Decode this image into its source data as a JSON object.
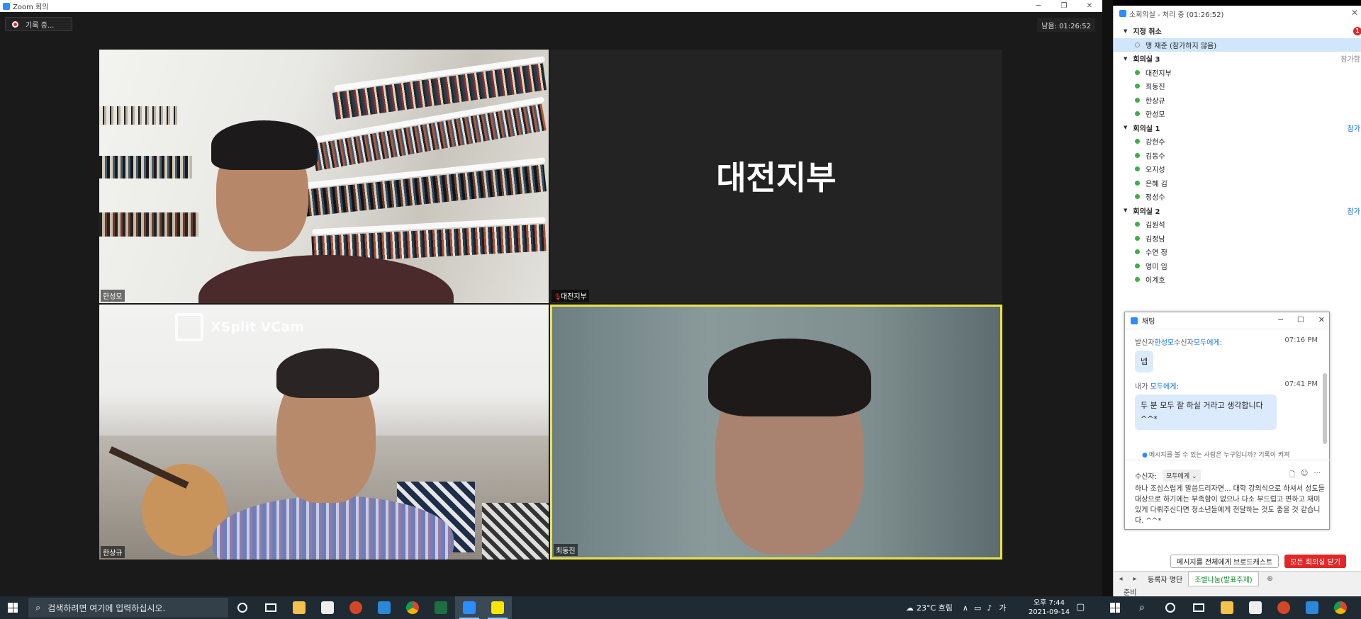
{
  "window": {
    "title": "Zoom 회의",
    "minimize": "─",
    "restore": "❐",
    "close": "✕"
  },
  "recording": {
    "label": "기록 중..."
  },
  "timer": {
    "text": "남음: 01:26:52"
  },
  "tiles": [
    {
      "name": "한성모"
    },
    {
      "name": "대전지부",
      "center_label": "대전지부"
    },
    {
      "name": "한상규",
      "overlay": "XSplit VCam"
    },
    {
      "name": "최동진"
    }
  ],
  "breakout": {
    "title": "소회의실 - 처리 중 (01:26:52)",
    "close": "✕",
    "groups": [
      {
        "label": "지정 취소",
        "badge": "1",
        "members": [
          {
            "name": "맹 재준 (참가하지 않음)",
            "joined": false
          }
        ]
      },
      {
        "label": "회의실 3",
        "action": "참가함",
        "members": [
          {
            "name": "대전지부",
            "joined": true
          },
          {
            "name": "최동진",
            "joined": true
          },
          {
            "name": "한상규",
            "joined": true
          },
          {
            "name": "한성모",
            "joined": true
          }
        ]
      },
      {
        "label": "회의실 1",
        "action": "참가",
        "members": [
          {
            "name": "강현수",
            "joined": true
          },
          {
            "name": "김동수",
            "joined": true
          },
          {
            "name": "오지성",
            "joined": true
          },
          {
            "name": "은혜 김",
            "joined": true
          },
          {
            "name": "정성수",
            "joined": true
          }
        ]
      },
      {
        "label": "회의실 2",
        "action": "참가",
        "members": [
          {
            "name": "김원석",
            "joined": true
          },
          {
            "name": "김정남",
            "joined": true
          },
          {
            "name": "수연 정",
            "joined": true
          },
          {
            "name": "영미 임",
            "joined": true
          },
          {
            "name": "이계호",
            "joined": true
          }
        ]
      }
    ],
    "broadcast_button": "메시지를 전체에게 브로드캐스트",
    "close_all_button": "모든 회의실 닫기",
    "tabs": [
      "등록자 명단",
      "조별나눔(발표주제)"
    ],
    "status": "준비"
  },
  "chat": {
    "title": "채팅",
    "messages": [
      {
        "sender_prefix": "발신자",
        "sender": "한성모",
        "recipient_prefix": "수신자",
        "recipient": "모두에게",
        "suffix": ":",
        "time": "07:16 PM",
        "text": "넵"
      },
      {
        "sender_prefix": "내가",
        "sender": "",
        "recipient_prefix": "",
        "recipient": "모두에게",
        "suffix": ":",
        "time": "07:41 PM",
        "text": "두 분 모두 잘 하실 거라고 생각합니다^^*"
      }
    ],
    "who_can_see": "메시지를 볼 수 있는 사람은 누구입니까? 기록이 켜져",
    "recipient_label": "수신자:",
    "recipient_value": "모두에게 ⌄",
    "input_text": "하나 조심스럽게 말씀드리자면... 대학 강의식으로 하셔서 성도들 대상으로 하기에는 부족함이 없으나 다소 부드럽고 편하고 재미있게 다뤄주신다면 청소년들에게 전달하는 것도 좋을 것 같습니다. ^^*"
  },
  "taskbar": {
    "search_placeholder": "검색하려면 여기에 입력하십시오.",
    "weather": "23°C 흐림",
    "ime": "가",
    "time": "오후 7:44",
    "date": "2021-09-14"
  },
  "colors": {
    "zoom_blue": "#2d8cff",
    "active_speaker": "#e8e24a",
    "red": "#e02828",
    "online_green": "#3fae49"
  }
}
